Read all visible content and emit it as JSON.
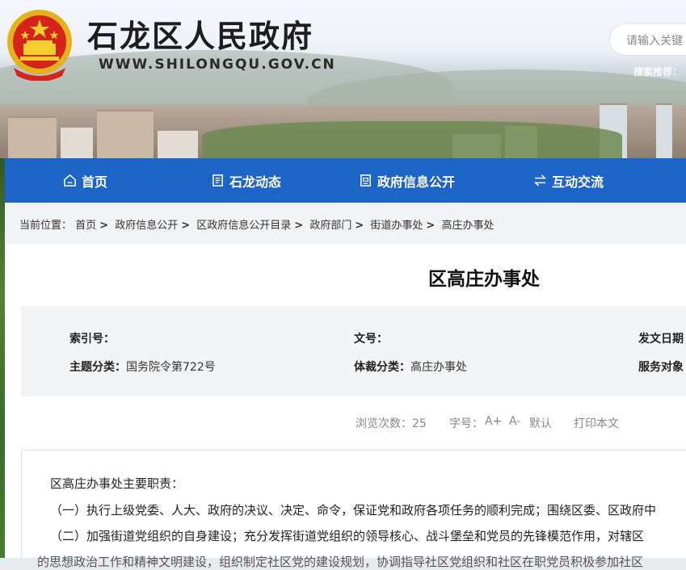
{
  "header": {
    "site_title": "石龙区人民政府",
    "site_url": "WWW.SHILONGQU.GOV.CN",
    "search_placeholder": "请输入关键",
    "hot_search_label": "搜索推荐："
  },
  "nav": {
    "items": [
      {
        "label": "首页",
        "icon": "home-icon"
      },
      {
        "label": "石龙动态",
        "icon": "news-icon"
      },
      {
        "label": "政府信息公开",
        "icon": "document-icon"
      },
      {
        "label": "互动交流",
        "icon": "exchange-icon"
      }
    ]
  },
  "breadcrumb": {
    "label": "当前位置：",
    "items": [
      "首页",
      "政府信息公开",
      "区政府信息公开目录",
      "政府部门",
      "街道办事处",
      "高庄办事处"
    ]
  },
  "article": {
    "title": "区高庄办事处",
    "meta": {
      "index_no_label": "索引号：",
      "index_no_value": "",
      "doc_no_label": "文号：",
      "doc_no_value": "",
      "date_label": "发文日期",
      "subject_label": "主题分类：",
      "subject_value": "国务院令第722号",
      "genre_label": "体裁分类：",
      "genre_value": "高庄办事处",
      "audience_label": "服务对象"
    },
    "tools": {
      "views_label": "浏览次数：",
      "views_value": "25",
      "font_label": "字号：",
      "font_larger": "A+",
      "font_smaller": "A-",
      "font_default": "默认",
      "print": "打印本文"
    },
    "paragraphs": [
      "区高庄办事处主要职责：",
      "（一）执行上级党委、人大、政府的决议、决定、命令，保证党和政府各项任务的顺利完成；围绕区委、区政府中",
      "（二）加强街道党组织的自身建设；充分发挥街道党组织的领导核心、战斗堡垒和党员的先锋模范作用，对辖区",
      "的思想政治工作和精神文明建设，组织制定社区党的建设规划，协调指导社区党组织和社区在职党员积极参加社区"
    ]
  },
  "colors": {
    "nav_bg": "#1d64c8",
    "meta_bg": "#f3f4f6",
    "crumb_bg": "#f2f3f5"
  }
}
